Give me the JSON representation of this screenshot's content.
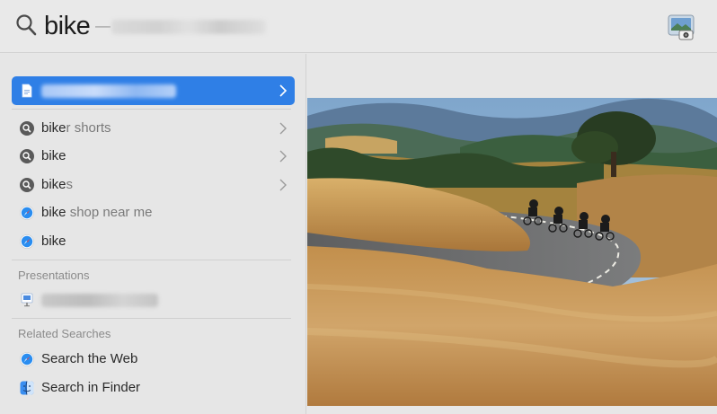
{
  "search": {
    "query": "bike",
    "suffix": "—"
  },
  "results": {
    "top_hit": {
      "label": "Coastal Bike Tour.jpeg",
      "icon": "image-file-icon"
    },
    "suggestions": [
      {
        "prefix": "bike",
        "rest": "r shorts",
        "icon": "search-icon"
      },
      {
        "prefix": "bike",
        "rest": "",
        "icon": "search-icon"
      },
      {
        "prefix": "bike",
        "rest": "s",
        "icon": "search-icon"
      },
      {
        "prefix": "bike",
        "rest": " shop near me",
        "icon": "safari-icon"
      },
      {
        "prefix": "bike",
        "rest": "",
        "icon": "safari-icon"
      }
    ],
    "presentations_title": "Presentations",
    "presentation_item": {
      "label": "Coil Showcase.key",
      "icon": "keynote-icon"
    },
    "related_title": "Related Searches",
    "related": [
      {
        "label": "Search the Web",
        "icon": "safari-icon"
      },
      {
        "label": "Search in Finder",
        "icon": "finder-icon"
      }
    ]
  },
  "colors": {
    "selection": "#2f7fe6",
    "background": "#e7e7e7"
  }
}
